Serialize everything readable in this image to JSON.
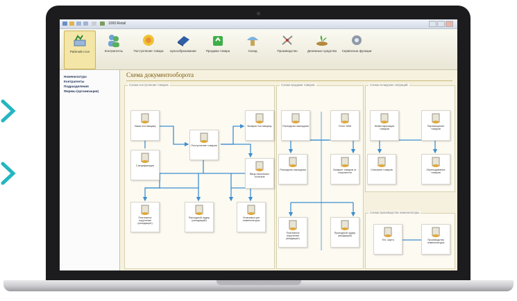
{
  "window": {
    "title": "1000:Retail"
  },
  "toolbar": {
    "items": [
      {
        "label": "Рабочий стол",
        "icon": "desktop-icon"
      },
      {
        "label": "Контрагенты",
        "icon": "users-icon"
      },
      {
        "label": "Поступление товара",
        "icon": "incoming-goods-icon"
      },
      {
        "label": "Ценообразование",
        "icon": "pricing-icon"
      },
      {
        "label": "Продажа товара",
        "icon": "sales-icon"
      },
      {
        "label": "Склад",
        "icon": "warehouse-icon"
      },
      {
        "label": "Производство",
        "icon": "production-icon"
      },
      {
        "label": "Денежные средства",
        "icon": "money-icon"
      },
      {
        "label": "Сервисные функции",
        "icon": "service-icon"
      }
    ]
  },
  "sidebar": {
    "items": [
      {
        "label": "Номенклатура"
      },
      {
        "label": "Контрагенты"
      },
      {
        "label": "Подразделения"
      },
      {
        "label": "Фирмы (организации)"
      }
    ]
  },
  "main": {
    "title": "Схема документооборота",
    "groups": [
      {
        "title": "Схема поступления товаров"
      },
      {
        "title": "Схема продажи товаров"
      },
      {
        "title": "Схема складских операций"
      },
      {
        "title": "Схема производства номенклатуры"
      }
    ],
    "nodes": [
      {
        "label": "Заказ поставщику"
      },
      {
        "label": "Поступление товаров"
      },
      {
        "label": "Возврат поставщику"
      },
      {
        "label": "Спецификация"
      },
      {
        "label": "Ввод начальных остатков"
      },
      {
        "label": "Платежное поручение (исходящее)"
      },
      {
        "label": "Расходный ордер (исходящий)"
      },
      {
        "label": "Установка цен номенклатуры"
      },
      {
        "label": "Расходная накладная"
      },
      {
        "label": "Отчет ККМ"
      },
      {
        "label": "Расходная накладная"
      },
      {
        "label": "Возврат товаров от покупателя"
      },
      {
        "label": "Платежное поручение (входящее)"
      },
      {
        "label": "Приходный ордер (входящий)"
      },
      {
        "label": "Инвентаризация товаров"
      },
      {
        "label": "Перемещение товаров"
      },
      {
        "label": "Списание товаров"
      },
      {
        "label": "Оприходование товаров"
      },
      {
        "label": "Тех. карта"
      },
      {
        "label": "Производство номенклатуры"
      }
    ]
  },
  "colors": {
    "accent": "#7a5a0e",
    "connector": "#3c8ed0",
    "brand_chevron": "#24b6c0"
  }
}
